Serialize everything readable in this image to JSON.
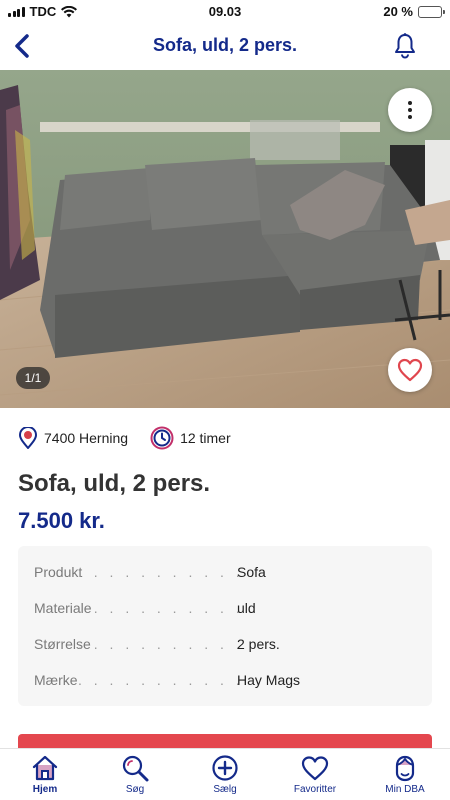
{
  "status_bar": {
    "carrier": "TDC",
    "time": "09.03",
    "battery_percent_label": "20 %",
    "battery_level": 0.2
  },
  "header": {
    "title": "Sofa, uld, 2 pers.",
    "back_icon": "chevron-left-icon",
    "notify_icon": "bell-icon"
  },
  "gallery": {
    "counter": "1/1",
    "more_icon": "vertical-dots-icon",
    "favorite_icon": "heart-icon"
  },
  "listing": {
    "location": "7400 Herning",
    "age": "12 timer",
    "title": "Sofa, uld, 2 pers.",
    "price": "7.500 kr."
  },
  "specs": [
    {
      "label": "Produkt",
      "value": "Sofa"
    },
    {
      "label": "Materiale",
      "value": "uld"
    },
    {
      "label": "Størrelse",
      "value": "2 pers."
    },
    {
      "label": "Mærke",
      "value": "Hay Mags"
    }
  ],
  "spec_leader": ". . . . . . . . . . . . . . .",
  "tabbar": [
    {
      "label": "Hjem",
      "icon": "home-icon",
      "active": true
    },
    {
      "label": "Søg",
      "icon": "search-icon",
      "active": false
    },
    {
      "label": "Sælg",
      "icon": "plus-circle-icon",
      "active": false
    },
    {
      "label": "Favoritter",
      "icon": "heart-icon",
      "active": false
    },
    {
      "label": "Min DBA",
      "icon": "profile-icon",
      "active": false
    }
  ],
  "colors": {
    "brand_blue": "#142a8a",
    "accent_red": "#e4474e",
    "heart_red": "#e0464e"
  }
}
